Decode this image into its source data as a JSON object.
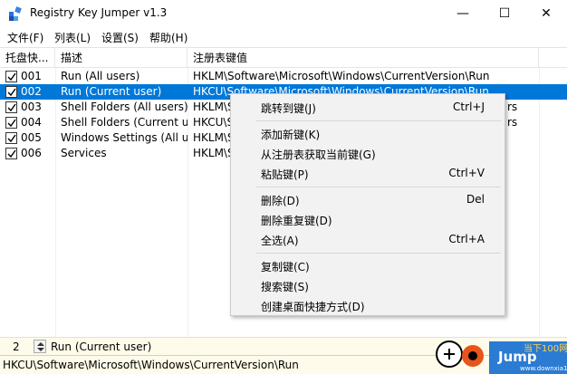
{
  "window": {
    "title": "Registry Key Jumper v1.3",
    "minimize": "—",
    "maximize": "☐",
    "close": "✕"
  },
  "menu": [
    "文件(F)",
    "列表(L)",
    "设置(S)",
    "帮助(H)"
  ],
  "columns": {
    "key": "托盘快...",
    "desc": "描述",
    "path": "注册表键值"
  },
  "rows": [
    {
      "key": "001",
      "desc": "Run (All users)",
      "path": "HKLM\\Software\\Microsoft\\Windows\\CurrentVersion\\Run",
      "checked": true,
      "selected": false
    },
    {
      "key": "002",
      "desc": "Run (Current user)",
      "path": "HKCU\\Software\\Microsoft\\Windows\\CurrentVersion\\Run",
      "checked": true,
      "selected": true
    },
    {
      "key": "003",
      "desc": "Shell Folders (All users)",
      "path": "HKLM\\Sof",
      "tail": "rs",
      "checked": true,
      "selected": false
    },
    {
      "key": "004",
      "desc": "Shell Folders (Current user)",
      "path": "HKCU\\So",
      "tail": "rs",
      "checked": true,
      "selected": false
    },
    {
      "key": "005",
      "desc": "Windows Settings (All users)",
      "path": "HKLM\\So",
      "checked": true,
      "selected": false
    },
    {
      "key": "006",
      "desc": "Services",
      "path": "HKLM\\SY",
      "checked": true,
      "selected": false
    }
  ],
  "context_menu": [
    {
      "label": "跳转到键(J)",
      "shortcut": "Ctrl+J"
    },
    {
      "label": "添加新键(K)",
      "shortcut": ""
    },
    {
      "label": "从注册表获取当前键(G)",
      "shortcut": ""
    },
    {
      "label": "粘贴键(P)",
      "shortcut": "Ctrl+V"
    },
    {
      "label": "删除(D)",
      "shortcut": "Del"
    },
    {
      "label": "删除重复键(D)",
      "shortcut": ""
    },
    {
      "label": "全选(A)",
      "shortcut": "Ctrl+A"
    },
    {
      "label": "复制键(C)",
      "shortcut": ""
    },
    {
      "label": "搜索键(S)",
      "shortcut": ""
    },
    {
      "label": "创建桌面快捷方式(D)",
      "shortcut": ""
    }
  ],
  "status": {
    "number": "2",
    "description": "Run (Current user)",
    "path": "HKCU\\Software\\Microsoft\\Windows\\CurrentVersion\\Run"
  },
  "brand": {
    "jump_text": "Jump",
    "site_text": "当下100网",
    "site_url": "www.downxia100.com"
  },
  "colors": {
    "selection": "#0078d7",
    "status_bg": "#fffbea",
    "menu_bg": "#f2f2f2"
  }
}
